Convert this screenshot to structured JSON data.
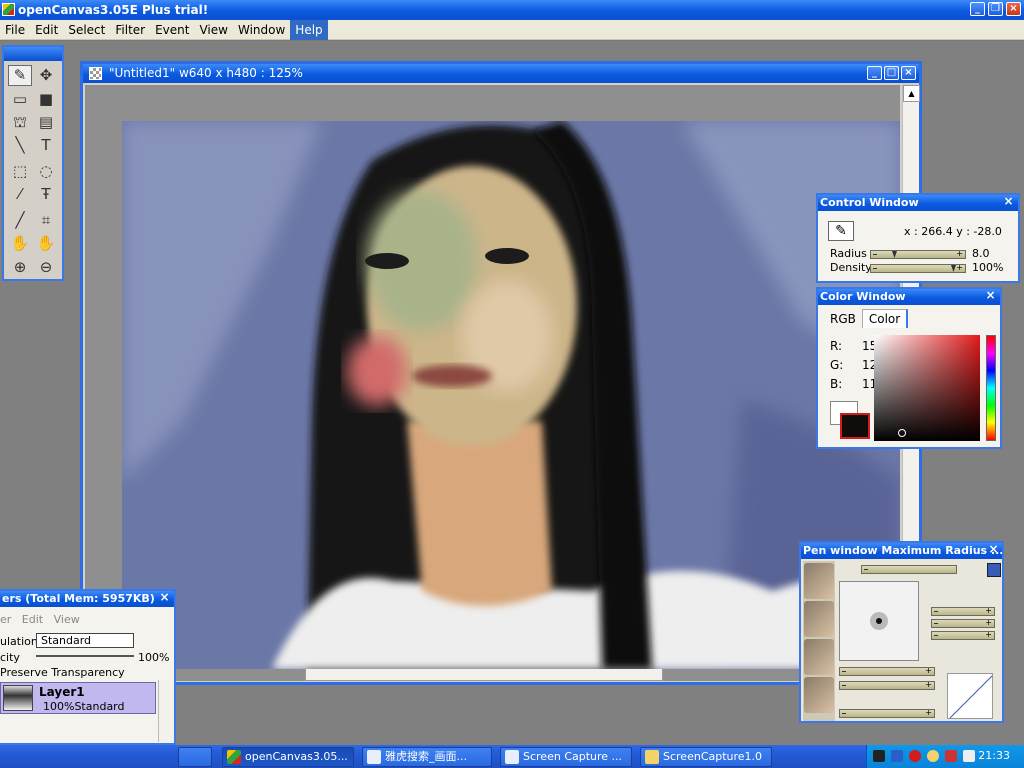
{
  "app": {
    "title": "openCanvas3.05E Plus trial!"
  },
  "menu": [
    {
      "label": "File"
    },
    {
      "label": "Edit"
    },
    {
      "label": "Select"
    },
    {
      "label": "Filter"
    },
    {
      "label": "Event"
    },
    {
      "label": "View"
    },
    {
      "label": "Window"
    },
    {
      "label": "Help"
    }
  ],
  "menu_active": "Help",
  "canvas_window": {
    "title": "\"Untitled1\" w640 x h480 : 125%"
  },
  "tools": [
    "pen-icon",
    "move-icon",
    "rect-outline-icon",
    "fill-rect-icon",
    "bucket-icon",
    "gradient-icon",
    "line-icon",
    "text-icon",
    "marquee-icon",
    "lasso-icon",
    "wand-icon",
    "text-select-icon",
    "eyedropper-icon",
    "crop-icon",
    "hand-icon",
    "rotate-hand-icon",
    "zoom-in-icon",
    "zoom-out-icon"
  ],
  "control_window": {
    "title": "Control Window",
    "coords": "x : 266.4   y : -28.0",
    "radius_label": "Radius",
    "radius_value": "8.0",
    "radius_level": 0.18,
    "density_label": "Density",
    "density_value": "100%",
    "density_level": 1.0
  },
  "color_window": {
    "title": "Color Window",
    "tabs": [
      "RGB",
      "Color"
    ],
    "active_tab": "Color",
    "r_label": "R:",
    "r_value": "15",
    "g_label": "G:",
    "g_value": "12",
    "b_label": "B:",
    "b_value": "11",
    "foreground": "#0f0c0b",
    "background": "#ffffff"
  },
  "pen_window": {
    "title": "Pen window  Maximum Radius ..."
  },
  "layers_window": {
    "title": "ers (Total Mem: 5957KB)",
    "menu": [
      "er",
      "Edit",
      "View"
    ],
    "blend_label": "ulation",
    "blend_value": "Standard",
    "opacity_label": "city",
    "opacity_value": "100%",
    "preserve_label": "Preserve Transparency",
    "layer_name": "Layer1",
    "layer_info": "100%Standard"
  },
  "taskbar": {
    "items": [
      {
        "label": ""
      },
      {
        "label": "openCanvas3.05..."
      },
      {
        "label": "雅虎搜索_画面..."
      },
      {
        "label": "Screen Capture ..."
      },
      {
        "label": "ScreenCapture1.0"
      }
    ],
    "clock": "21:33"
  }
}
